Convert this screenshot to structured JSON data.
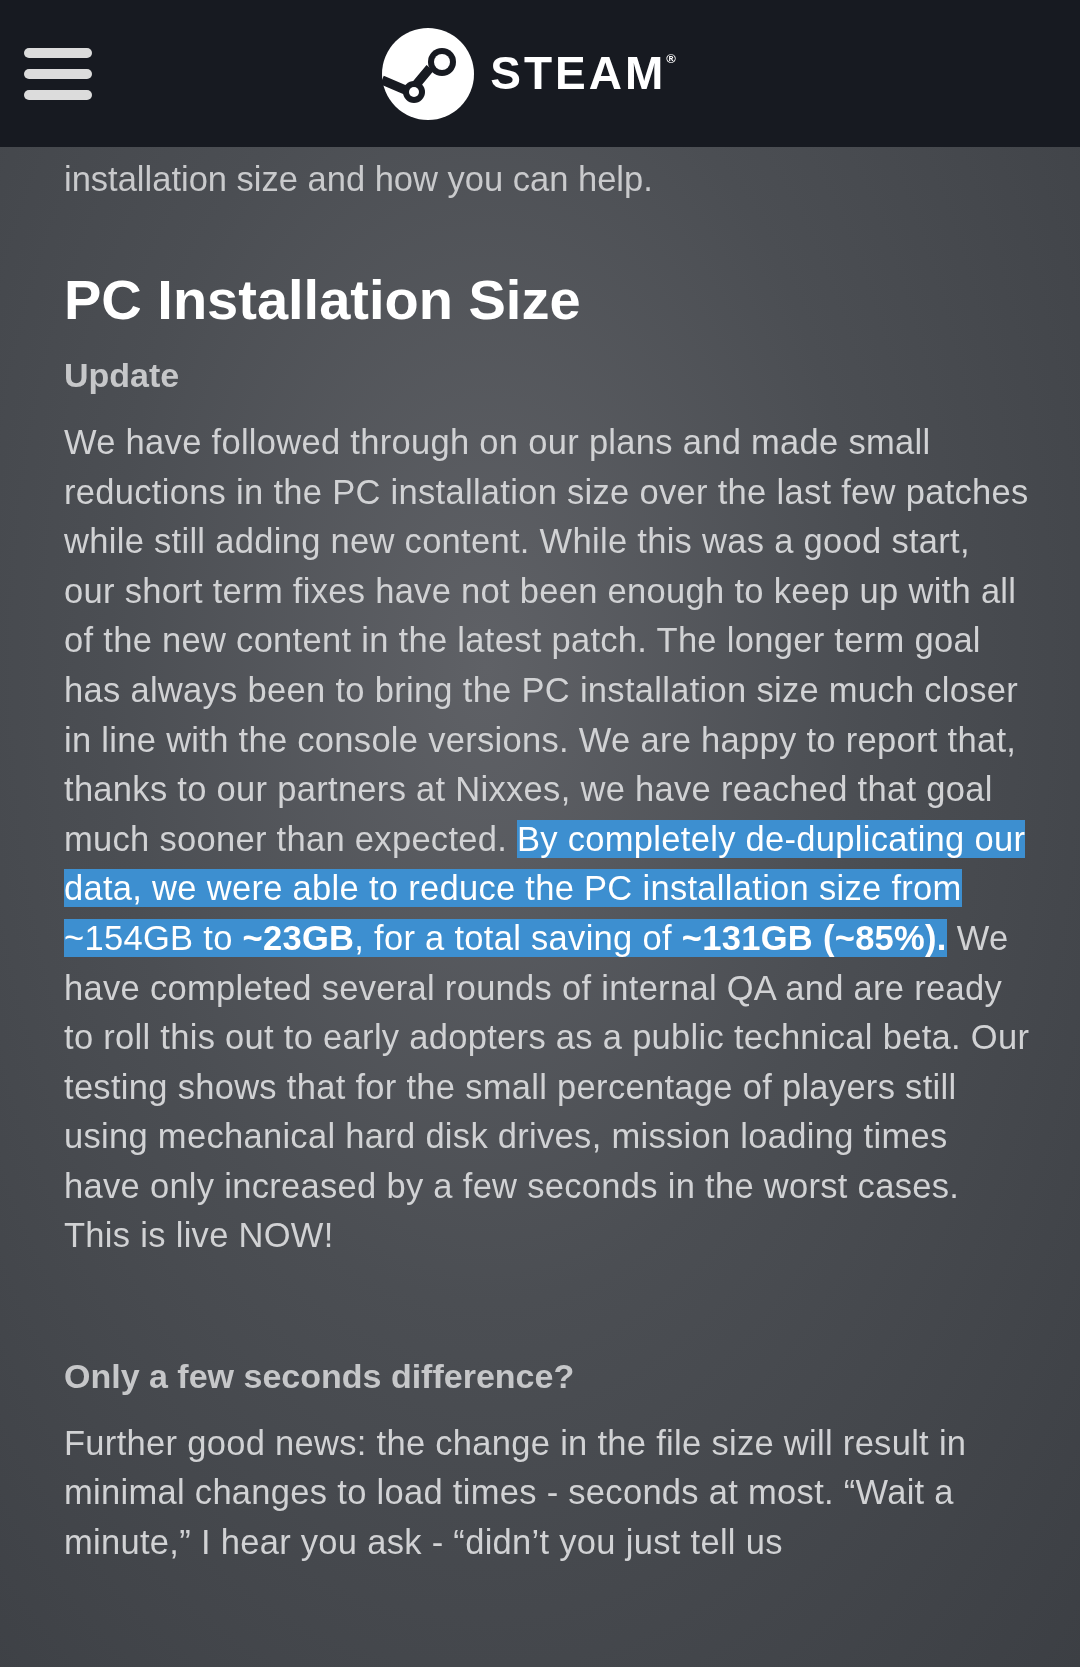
{
  "header": {
    "brand": "STEAM$^{®}$"
  },
  "intro_tail": "installation size and how you can help.",
  "sections": [
    {
      "heading": "PC Installation Size",
      "subheading": "Update",
      "paragraphs": [
        [
          {
            "text": "We have followed through on our plans and made small reductions in the PC installation size over the last few patches while still adding new content. While this was a good start, our short term fixes have not been enough to keep up with all of the new content in the latest patch. The longer term goal has always been to bring the PC installation size much closer in line with the console versions. We are happy to report that, thanks to our partners at Nixxes, we have reached that goal much sooner than expected. ",
            "selected": false
          },
          {
            "text": "By completely de-duplicating our data, we were able to reduce the PC installation size from ~154GB to **~23GB**, for a total saving of **~131GB (~85%).**",
            "selected": true
          },
          {
            "text": " We have completed several rounds of internal QA and are ready to roll this out to early adopters as a public technical beta. Our testing shows that for the small percentage of players still using mechanical hard disk drives, mission loading times have only increased by a few seconds in the worst cases. This is live NOW!",
            "selected": false
          }
        ]
      ]
    },
    {
      "subheading": "Only a few seconds difference?",
      "paragraphs": [
        [
          {
            "text": "Further good news: the change in the file size will result in minimal changes to load times - seconds at most. “Wait a minute,” I hear you ask - “didn’t you just tell us",
            "selected": false
          }
        ]
      ]
    }
  ]
}
